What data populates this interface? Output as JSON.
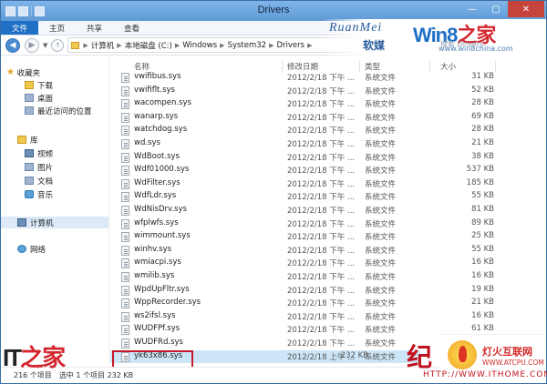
{
  "window": {
    "title": "Drivers"
  },
  "ribbon": {
    "tabs": [
      "文件",
      "主页",
      "共享",
      "查看"
    ]
  },
  "address": {
    "crumbs": [
      "计算机",
      "本地磁盘 (C:)",
      "Windows",
      "System32",
      "Drivers"
    ]
  },
  "search": {
    "placeholder": "搜索 Drivers"
  },
  "watermark": {
    "brand_en": "RuanMei",
    "brand_cn": "软媒",
    "win8_a": "Win8",
    "win8_b": "之家",
    "url": "www.win8china.com",
    "it_a": "IT",
    "it_b": "之家",
    "atcpu_cn": "灯火互联网",
    "atcpu_url": "WWW.ATCPU.COM",
    "corner": "HTTP://WWW.ITHOME.COM",
    "red_mark": "纪"
  },
  "columns": {
    "name": "名称",
    "date": "修改日期",
    "type": "类型",
    "size": "大小"
  },
  "sidebar": {
    "favorites": "收藏夹",
    "fav_items": [
      "下载",
      "桌面",
      "最近访问的位置"
    ],
    "libraries": "库",
    "lib_items": [
      "视频",
      "图片",
      "文档",
      "音乐"
    ],
    "computer": "计算机",
    "network": "网络"
  },
  "files": [
    {
      "name": "vwifibus.sys",
      "date": "2012/2/18 下午 ...",
      "type": "系统文件",
      "size": "31 KB"
    },
    {
      "name": "vwififlt.sys",
      "date": "2012/2/18 下午 ...",
      "type": "系统文件",
      "size": "52 KB"
    },
    {
      "name": "wacompen.sys",
      "date": "2012/2/18 下午 ...",
      "type": "系统文件",
      "size": "28 KB"
    },
    {
      "name": "wanarp.sys",
      "date": "2012/2/18 下午 ...",
      "type": "系统文件",
      "size": "69 KB"
    },
    {
      "name": "watchdog.sys",
      "date": "2012/2/18 下午 ...",
      "type": "系统文件",
      "size": "28 KB"
    },
    {
      "name": "wd.sys",
      "date": "2012/2/18 下午 ...",
      "type": "系统文件",
      "size": "21 KB"
    },
    {
      "name": "WdBoot.sys",
      "date": "2012/2/18 下午 ...",
      "type": "系统文件",
      "size": "38 KB"
    },
    {
      "name": "Wdf01000.sys",
      "date": "2012/2/18 下午 ...",
      "type": "系统文件",
      "size": "537 KB"
    },
    {
      "name": "WdFilter.sys",
      "date": "2012/2/18 下午 ...",
      "type": "系统文件",
      "size": "185 KB"
    },
    {
      "name": "WdfLdr.sys",
      "date": "2012/2/18 下午 ...",
      "type": "系统文件",
      "size": "55 KB"
    },
    {
      "name": "WdNisDrv.sys",
      "date": "2012/2/18 下午 ...",
      "type": "系统文件",
      "size": "81 KB"
    },
    {
      "name": "wfplwfs.sys",
      "date": "2012/2/18 下午 ...",
      "type": "系统文件",
      "size": "89 KB"
    },
    {
      "name": "wimmount.sys",
      "date": "2012/2/18 下午 ...",
      "type": "系统文件",
      "size": "25 KB"
    },
    {
      "name": "winhv.sys",
      "date": "2012/2/18 下午 ...",
      "type": "系统文件",
      "size": "55 KB"
    },
    {
      "name": "wmiacpi.sys",
      "date": "2012/2/18 下午 ...",
      "type": "系统文件",
      "size": "16 KB"
    },
    {
      "name": "wmilib.sys",
      "date": "2012/2/18 下午 ...",
      "type": "系统文件",
      "size": "16 KB"
    },
    {
      "name": "WpdUpFltr.sys",
      "date": "2012/2/18 下午 ...",
      "type": "系统文件",
      "size": "19 KB"
    },
    {
      "name": "WppRecorder.sys",
      "date": "2012/2/18 下午 ...",
      "type": "系统文件",
      "size": "21 KB"
    },
    {
      "name": "ws2ifsl.sys",
      "date": "2012/2/18 下午 ...",
      "type": "系统文件",
      "size": "16 KB"
    },
    {
      "name": "WUDFPf.sys",
      "date": "2012/2/18 下午 ...",
      "type": "系统文件",
      "size": "61 KB"
    },
    {
      "name": "WUDFRd.sys",
      "date": "2012/2/18 下午 ...",
      "type": "系统文件",
      "size": "147 KB"
    },
    {
      "name": "yk63x86.sys",
      "date": "2012/2/18 上午 ...",
      "type": "系统文件",
      "size": "232 KB"
    }
  ],
  "status": {
    "count": "216 个项目",
    "selected": "选中 1 个项目 232 KB"
  }
}
